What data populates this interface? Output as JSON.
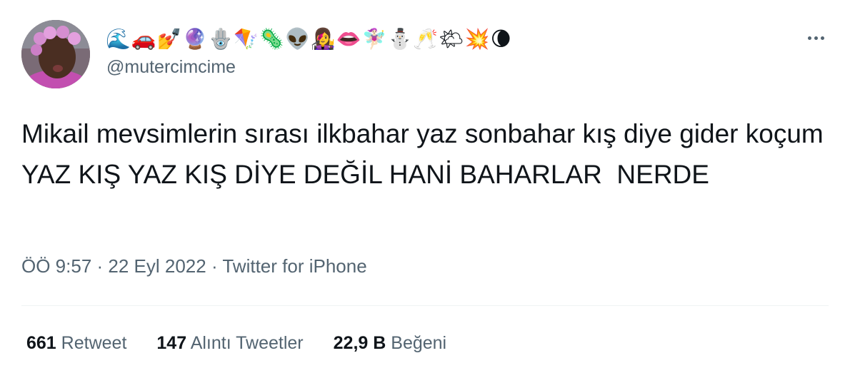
{
  "user": {
    "display_name": "🌊🚗💅🔮🪬🪁🦠👽👩‍🎤👄🧚🏻‍♀️⛄🥂🌤💥🌘",
    "handle": "@mutercimcime"
  },
  "tweet": {
    "text": "Mikail mevsimlerin sırası ilkbahar yaz sonbahar kış diye gider koçum YAZ KIŞ YAZ KIŞ DİYE DEĞİL HANİ BAHARLAR  NERDE",
    "time": "ÖÖ 9:57",
    "sep1": " · ",
    "date": "22 Eyl 2022",
    "sep2": " · ",
    "source": "Twitter for iPhone"
  },
  "stats": {
    "retweets_count": "661",
    "retweets_label": "Retweet",
    "quotes_count": "147",
    "quotes_label": "Alıntı Tweetler",
    "likes_count": "22,9 B",
    "likes_label": "Beğeni"
  },
  "icons": {
    "more": "more-horizontal-icon",
    "avatar": "profile-photo"
  },
  "colors": {
    "text_primary": "#0f1419",
    "text_secondary": "#536471",
    "divider": "#eff3f4"
  }
}
